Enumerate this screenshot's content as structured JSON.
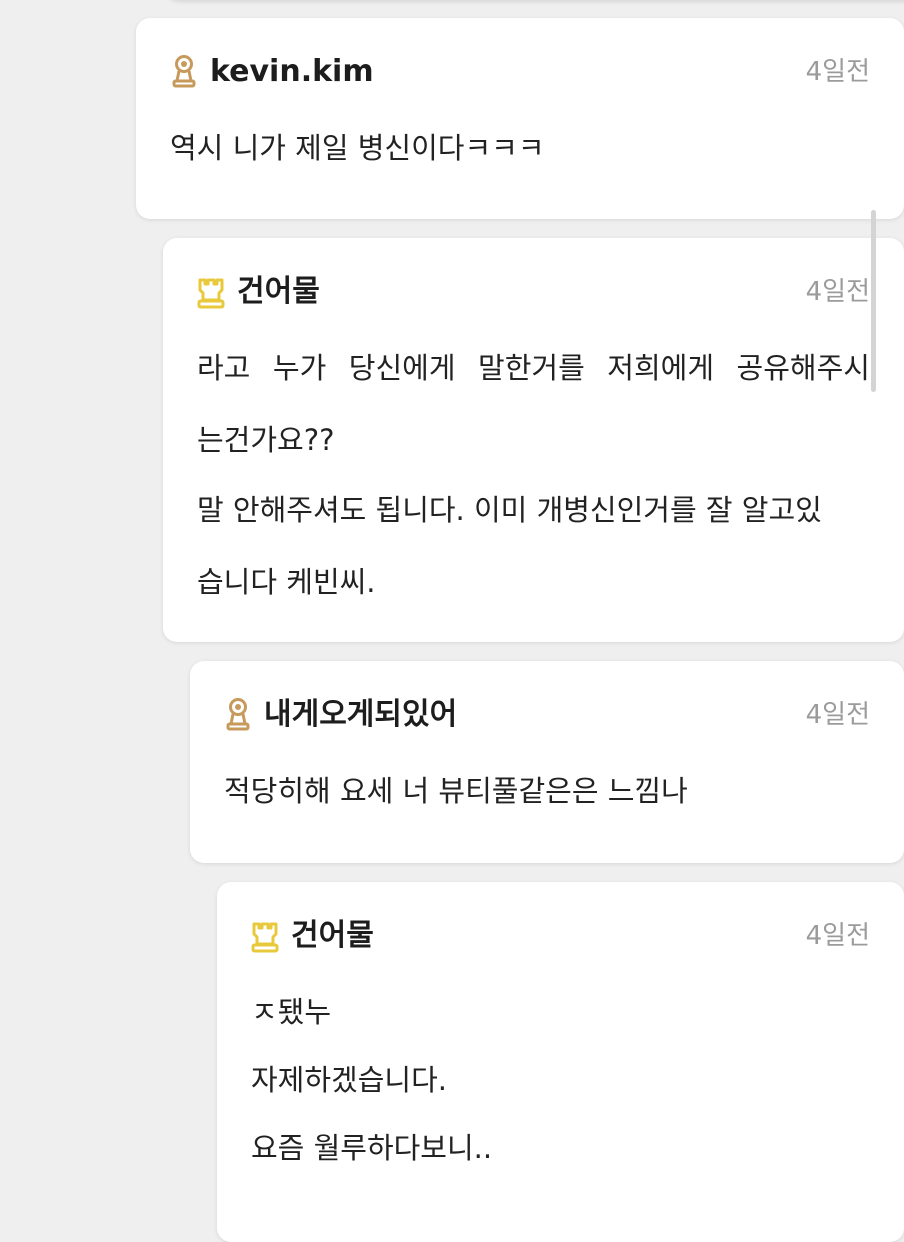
{
  "comments": [
    {
      "username": "kevin.kim",
      "rank_icon": "bronze-medal-icon",
      "timestamp": "4일전",
      "lines": [
        "역시 니가 제일 병신이다ㅋㅋㅋ"
      ]
    },
    {
      "username": "건어물",
      "rank_icon": "gold-crown-icon",
      "timestamp": "4일전",
      "lines": [
        [
          "라고",
          "누가",
          "당신에게",
          "말한거를",
          "저희에게",
          "공유해주시"
        ],
        "는건가요??",
        "말 안해주셔도 됩니다. 이미 개병신인거를 잘 알고있",
        "습니다 케빈씨."
      ]
    },
    {
      "username": "내게오게되있어",
      "rank_icon": "bronze-medal-icon",
      "timestamp": "4일전",
      "lines": [
        "적당히해 요세 너 뷰티풀같은은 느낌나"
      ]
    },
    {
      "username": "건어물",
      "rank_icon": "gold-crown-icon",
      "timestamp": "4일전",
      "lines": [
        "ㅈ됐누",
        "자제하겠습니다.",
        "요즘 월루하다보니.."
      ]
    }
  ],
  "colors": {
    "background": "#efefef",
    "card": "#ffffff",
    "timestamp": "#9b9b9b",
    "bronze": "#c79a5c",
    "gold": "#e8c93b"
  }
}
